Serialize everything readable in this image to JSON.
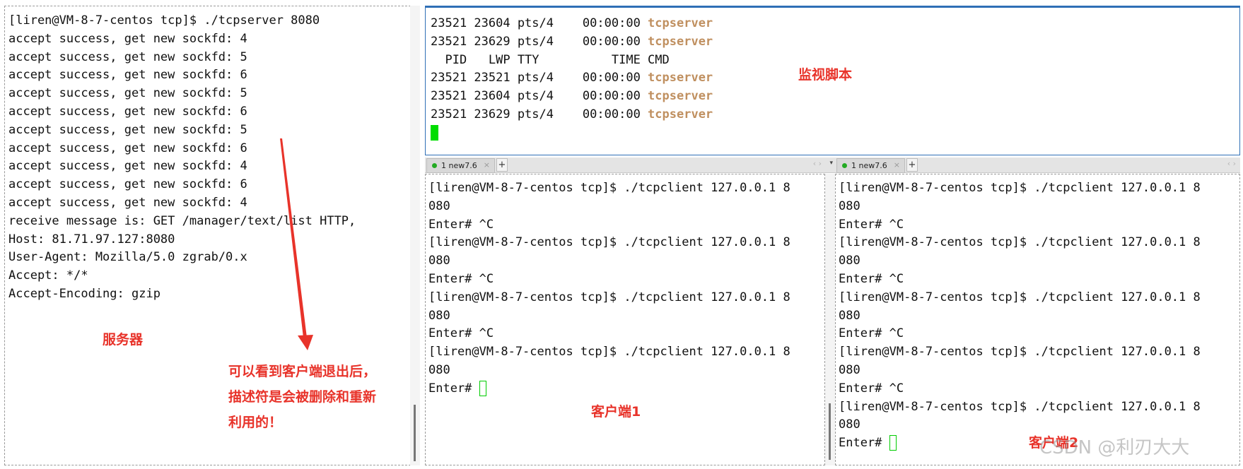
{
  "server": {
    "lines": [
      "[liren@VM-8-7-centos tcp]$ ./tcpserver 8080",
      "accept success, get new sockfd: 4",
      "accept success, get new sockfd: 5",
      "accept success, get new sockfd: 6",
      "accept success, get new sockfd: 5",
      "accept success, get new sockfd: 6",
      "accept success, get new sockfd: 5",
      "accept success, get new sockfd: 6",
      "accept success, get new sockfd: 4",
      "accept success, get new sockfd: 6",
      "accept success, get new sockfd: 4",
      "receive message is: GET /manager/text/list HTTP,",
      "Host: 81.71.97.127:8080",
      "User-Agent: Mozilla/5.0 zgrab/0.x",
      "Accept: */*",
      "Accept-Encoding: gzip"
    ]
  },
  "monitor": {
    "rows": [
      {
        "text": "23521 23604 pts/4    00:00:00 ",
        "proc": "tcpserver"
      },
      {
        "text": "23521 23629 pts/4    00:00:00 ",
        "proc": "tcpserver"
      },
      {
        "text": "  PID   LWP TTY          TIME CMD",
        "proc": ""
      },
      {
        "text": "23521 23521 pts/4    00:00:00 ",
        "proc": "tcpserver"
      },
      {
        "text": "23521 23604 pts/4    00:00:00 ",
        "proc": "tcpserver"
      },
      {
        "text": "23521 23629 pts/4    00:00:00 ",
        "proc": "tcpserver"
      }
    ]
  },
  "tabs": {
    "left": {
      "label": "1 new7.6",
      "close": "×",
      "add": "+",
      "arrows": "‹ ›",
      "dropdown": "▾"
    },
    "right": {
      "label": "1 new7.6",
      "close": "×",
      "add": "+",
      "arrows": "‹ ›"
    }
  },
  "client1": {
    "lines": [
      "[liren@VM-8-7-centos tcp]$ ./tcpclient 127.0.0.1 8",
      "080",
      "Enter# ^C",
      "[liren@VM-8-7-centos tcp]$ ./tcpclient 127.0.0.1 8",
      "080",
      "Enter# ^C",
      "[liren@VM-8-7-centos tcp]$ ./tcpclient 127.0.0.1 8",
      "080",
      "Enter# ^C",
      "[liren@VM-8-7-centos tcp]$ ./tcpclient 127.0.0.1 8",
      "080"
    ],
    "prompt": "Enter# "
  },
  "client2": {
    "lines": [
      "[liren@VM-8-7-centos tcp]$ ./tcpclient 127.0.0.1 8",
      "080",
      "Enter# ^C",
      "[liren@VM-8-7-centos tcp]$ ./tcpclient 127.0.0.1 8",
      "080",
      "Enter# ^C",
      "[liren@VM-8-7-centos tcp]$ ./tcpclient 127.0.0.1 8",
      "080",
      "Enter# ^C",
      "[liren@VM-8-7-centos tcp]$ ./tcpclient 127.0.0.1 8",
      "080",
      "Enter# ^C",
      "[liren@VM-8-7-centos tcp]$ ./tcpclient 127.0.0.1 8",
      "080"
    ],
    "prompt": "Enter# "
  },
  "annotations": {
    "server": "服务器",
    "monitor": "监视脚本",
    "client1": "客户端1",
    "client2": "客户端2",
    "note_line1": "可以看到客户端退出后，",
    "note_line2": "描述符是会被删除和重新",
    "note_line3": "利用的！"
  },
  "watermark": "CSDN @利刃大大",
  "colors": {
    "annotation": "#e8332a",
    "process_name": "#c09060",
    "cursor": "#00dd00",
    "pane_border_active": "#2f6fb6"
  }
}
